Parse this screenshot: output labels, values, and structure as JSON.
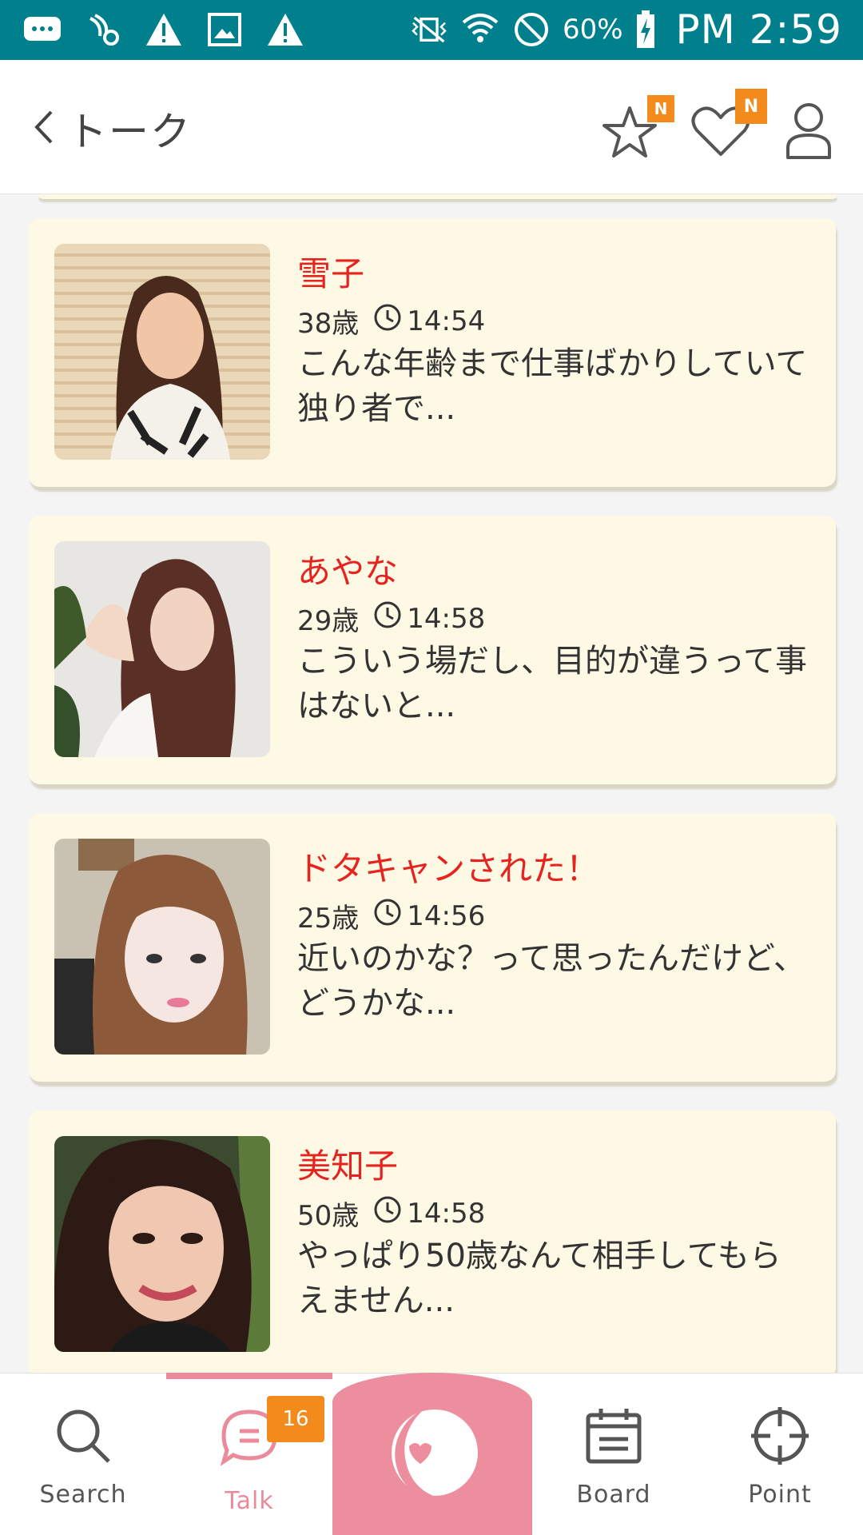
{
  "status_bar": {
    "battery": "60%",
    "time": "PM 2:59",
    "icons": [
      "chat-bubble-icon",
      "settings-icon",
      "warning-icon",
      "image-icon",
      "warning-icon",
      "vibrate-icon",
      "wifi-icon",
      "block-icon",
      "battery-charging-icon"
    ]
  },
  "header": {
    "back_label": "トーク",
    "favorites_badge": "N",
    "likes_badge": "N"
  },
  "messages": [
    {
      "name": "雪子",
      "age": "38歳",
      "time": "14:54",
      "text": "こんな年齢まで仕事ばかりしていて独り者で..."
    },
    {
      "name": "あやな",
      "age": "29歳",
      "time": "14:58",
      "text": "こういう場だし、目的が違うって事はないと..."
    },
    {
      "name": "ドタキャンされた！",
      "age": "25歳",
      "time": "14:56",
      "text": "近いのかな？って思ったんだけど、どうかな..."
    },
    {
      "name": "美知子",
      "age": "50歳",
      "time": "14:58",
      "text": "やっぱり50歳なんて相手してもらえません..."
    }
  ],
  "nav": {
    "search": "Search",
    "talk": "Talk",
    "talk_badge": "16",
    "board": "Board",
    "point": "Point"
  },
  "colors": {
    "status_bar": "#00808c",
    "accent_pink": "#ec8e9e",
    "badge_orange": "#f28a1c",
    "name_red": "#e5231f",
    "card_bg": "#fdf9e4"
  }
}
